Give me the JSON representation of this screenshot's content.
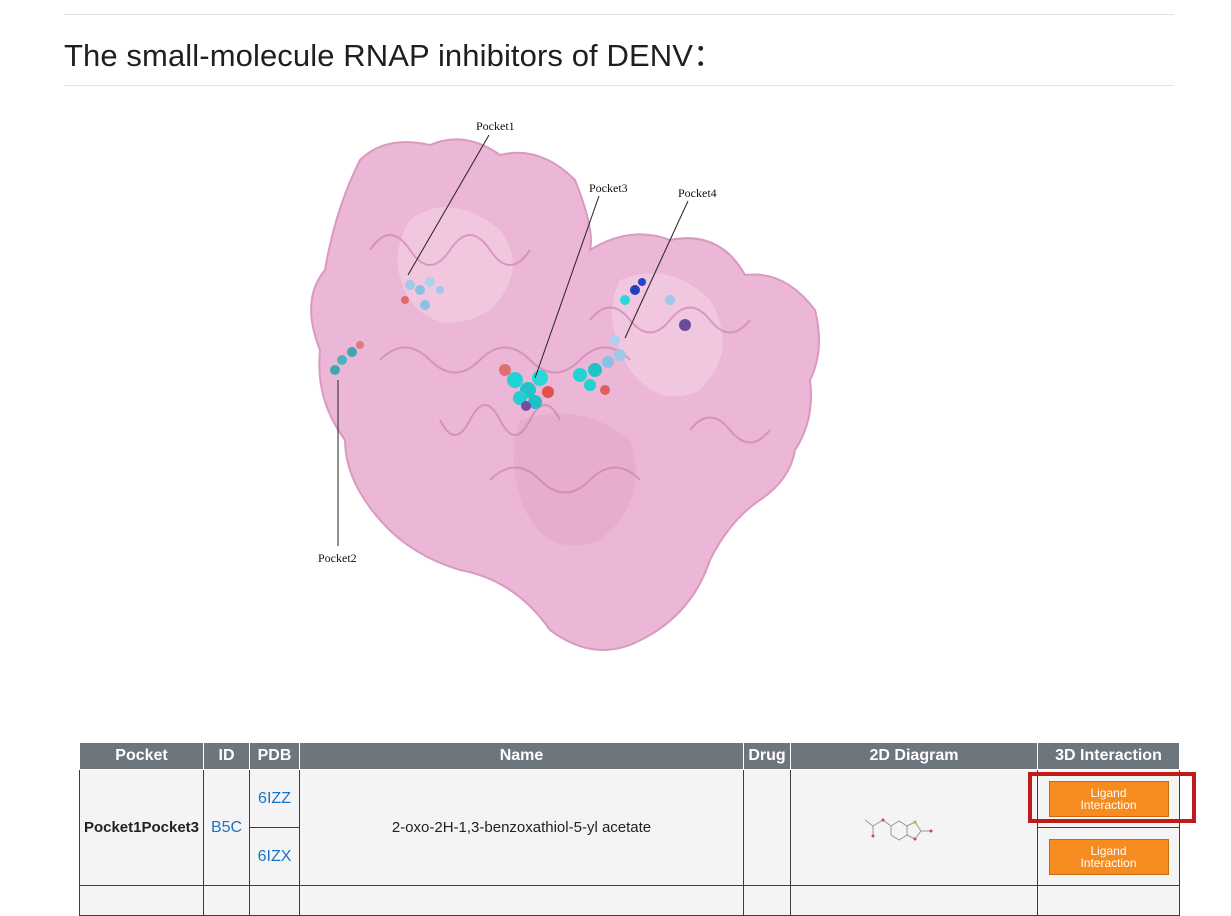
{
  "page": {
    "title": "The small-molecule RNAP inhibitors of DENV："
  },
  "figure": {
    "labels": [
      "Pocket1",
      "Pocket2",
      "Pocket3",
      "Pocket4"
    ]
  },
  "table": {
    "headers": [
      "Pocket",
      "ID",
      "PDB",
      "Name",
      "Drug",
      "2D Diagram",
      "3D Interaction"
    ],
    "rows": [
      {
        "pocket": "Pocket1Pocket3",
        "id": "B5C",
        "pdb": [
          "6IZZ",
          "6IZX"
        ],
        "name": "2-oxo-2H-1,3-benzoxathiol-5-yl acetate",
        "drug": "",
        "button_label": "Ligand Interaction"
      }
    ]
  },
  "colors": {
    "header_bg": "#6d757d",
    "button": "#f68c1f",
    "link": "#1a73c8",
    "highlight": "#c01a1a",
    "protein": "#ecb6d6"
  }
}
